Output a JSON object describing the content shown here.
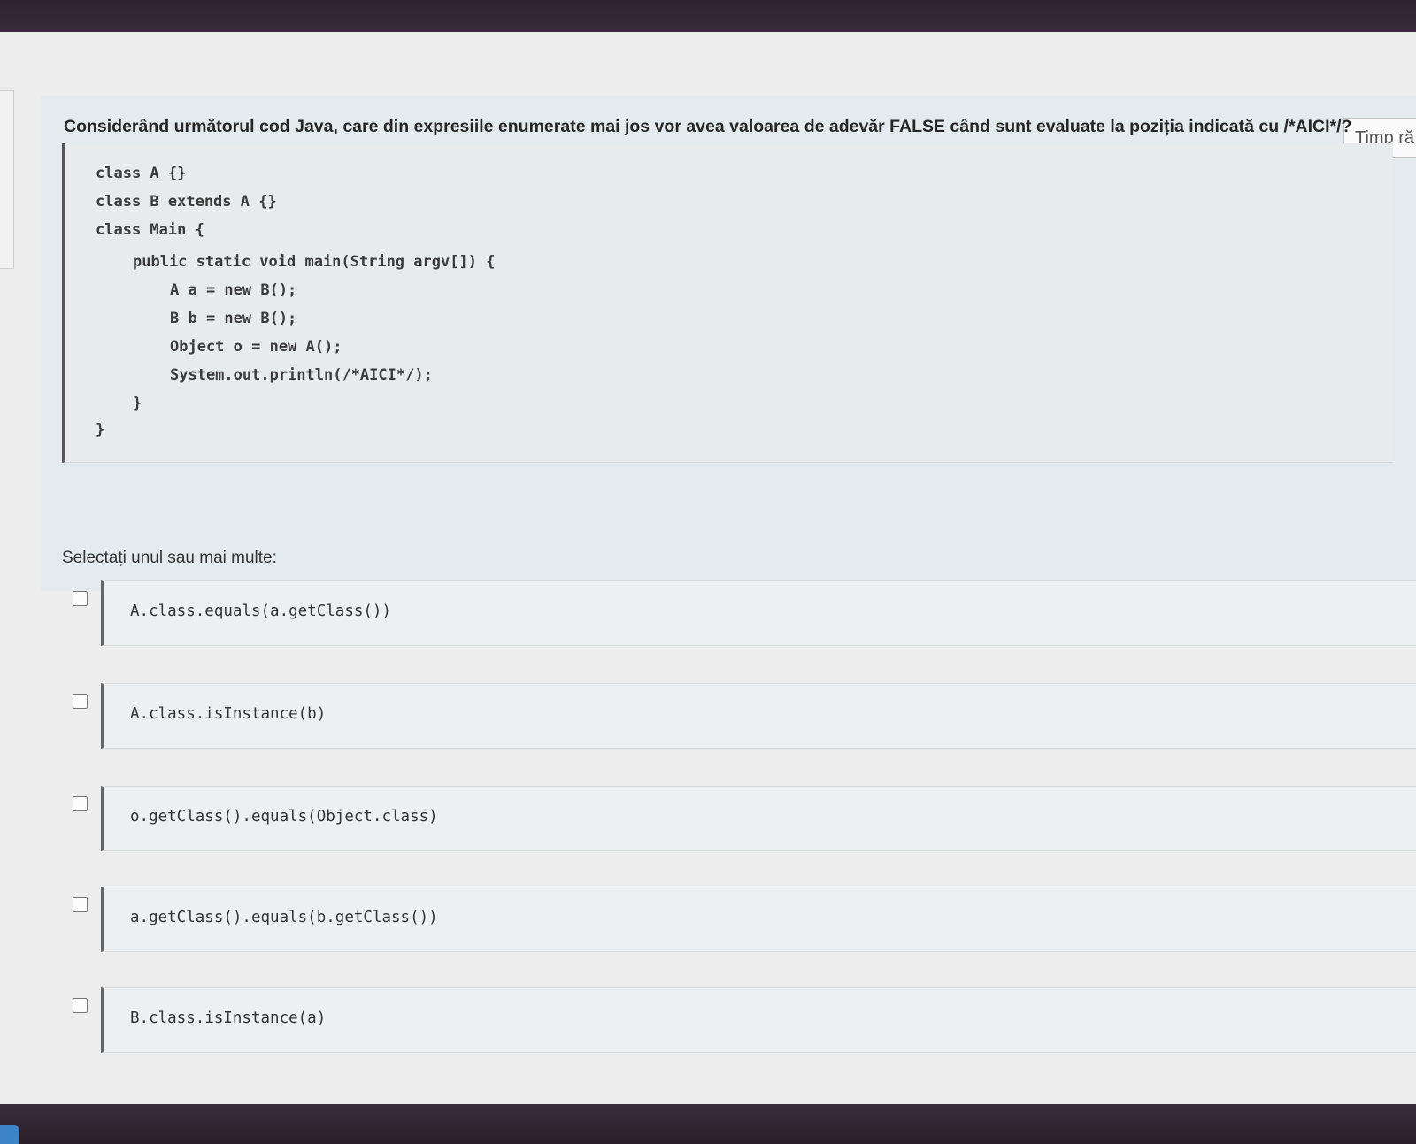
{
  "timer": {
    "label": "Timp ră"
  },
  "question": {
    "text": "Considerând următorul cod Java, care din expresiile enumerate mai jos vor avea valoarea de adevăr FALSE când sunt evaluate la poziția indicată cu /*AICI*/?",
    "code_lines": [
      "class A {}",
      "class B extends A {}",
      "class Main {",
      "public static void main(String argv[]) {",
      "A a = new B();",
      "B b = new B();",
      "Object o = new A();",
      "System.out.println(/*AICI*/);",
      "}",
      "}"
    ]
  },
  "answers": {
    "prompt": "Selectați unul sau mai multe:",
    "options": [
      {
        "code": "A.class.equals(a.getClass())",
        "checked": false
      },
      {
        "code": "A.class.isInstance(b)",
        "checked": false
      },
      {
        "code": "o.getClass().equals(Object.class)",
        "checked": false
      },
      {
        "code": "a.getClass().equals(b.getClass())",
        "checked": false
      },
      {
        "code": "B.class.isInstance(a)",
        "checked": false
      }
    ]
  }
}
